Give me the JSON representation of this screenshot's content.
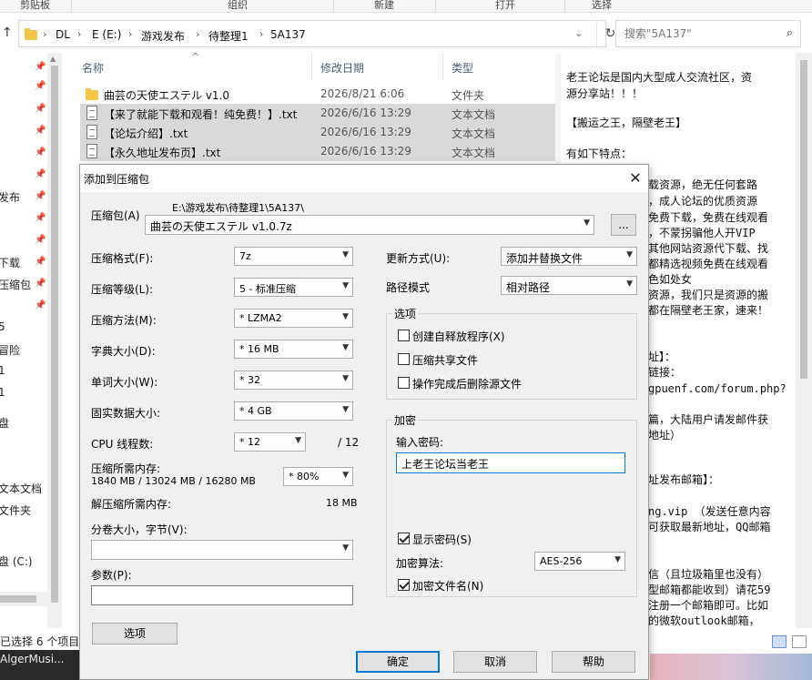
{
  "ribbon": {
    "groups": [
      "剪贴板",
      "组织",
      "新建",
      "打开",
      "选择"
    ]
  },
  "address": {
    "crumbs": [
      "DL",
      "E (E:)",
      "游戏发布",
      "待整理1",
      "5A137"
    ],
    "search_placeholder": "搜索\"5A137\""
  },
  "nav_pane": {
    "labels": [
      "发布",
      "下载",
      "压缩包",
      "5",
      "冒险",
      "1",
      "1",
      "盘",
      "文本文档",
      "文件夹",
      "盘 (C:)"
    ]
  },
  "file_list": {
    "columns": [
      "名称",
      "修改日期",
      "类型"
    ],
    "rows": [
      {
        "name": "曲芸の天使エステル v1.0",
        "date": "2026/8/21 6:06",
        "type": "文件夹",
        "icon": "folder-icon",
        "selected": false
      },
      {
        "name": "【来了就能下载和观看！纯免费！】.txt",
        "date": "2026/6/16 13:29",
        "type": "文本文档",
        "icon": "text-file-icon",
        "selected": true
      },
      {
        "name": "【论坛介绍】.txt",
        "date": "2026/6/16 13:29",
        "type": "文本文档",
        "icon": "text-file-icon",
        "selected": true
      },
      {
        "name": "【永久地址发布页】.txt",
        "date": "2026/6/16 13:29",
        "type": "文本文档",
        "icon": "text-file-icon",
        "selected": true
      }
    ]
  },
  "preview": {
    "lines_top": [
      "老王论坛是国内大型成人交流社区，资",
      "源分享站！！！",
      "",
      "【搬运之王，隔壁老王】",
      "",
      "有如下特点："
    ],
    "lines_right": [
      "载资源，绝无任何套路",
      "，成人论坛的优质资源",
      "免费下载，免费在线观看",
      "，不蒙拐骗他人开VIP",
      "其他网站资源代下载、找",
      "都精选视频免费在线观看",
      "色如处女",
      "资源，我们只是资源的搬",
      "都在隔壁老王家，速来！",
      "",
      "",
      "址】：",
      "链接：",
      "gpuenf.com/forum.php?",
      "",
      "篇，大陆用户请发邮件获",
      "地址）",
      "",
      "",
      "址发布邮箱】：",
      "",
      "ng.vip  （发送任意内容",
      "可获取最新地址，QQ邮箱",
      "",
      "",
      "信（且垃圾箱里也没有）",
      "型邮箱都能收到）请花59",
      "注册一个邮箱即可。比如",
      "的微软outlook邮箱，"
    ]
  },
  "status": {
    "text": "已选择 6 个项目"
  },
  "taskbar": {
    "app_label": "AlgerMusi..."
  },
  "dialog": {
    "title": "添加到压缩包",
    "archive_label": "压缩包(A)",
    "archive_path": "E:\\游戏发布\\待整理1\\5A137\\",
    "archive_name": "曲芸の天使エステル v1.0.7z",
    "browse_label": "...",
    "format_label": "压缩格式(F):",
    "format_value": "7z",
    "level_label": "压缩等级(L):",
    "level_value": "5 - 标准压缩",
    "method_label": "压缩方法(M):",
    "method_value": "* LZMA2",
    "dict_label": "字典大小(D):",
    "dict_value": "* 16 MB",
    "word_label": "单词大小(W):",
    "word_value": "* 32",
    "solid_label": "固实数据大小:",
    "solid_value": "* 4 GB",
    "threads_label": "CPU 线程数:",
    "threads_value": "* 12",
    "threads_total": "/ 12",
    "mem_label": "压缩所需内存:",
    "mem_values": "1840 MB / 13024 MB / 16280 MB",
    "mem_percent": "* 80%",
    "decomp_label": "解压缩所需内存:",
    "decomp_value": "18 MB",
    "split_label": "分卷大小，字节(V):",
    "split_value": "",
    "params_label": "参数(P):",
    "params_value": "",
    "options_button": "选项",
    "update_label": "更新方式(U):",
    "update_value": "添加并替换文件",
    "pathmode_label": "路径模式",
    "pathmode_value": "相对路径",
    "options_group": "选项",
    "opt_sfx": "创建自释放程序(X)",
    "opt_shared": "压缩共享文件",
    "opt_delete": "操作完成后删除源文件",
    "encrypt_group": "加密",
    "password_label": "输入密码:",
    "password_value": "上老王论坛当老王",
    "show_password": "显示密码(S)",
    "algo_label": "加密算法:",
    "algo_value": "AES-256",
    "encrypt_names": "加密文件名(N)",
    "ok": "确定",
    "cancel": "取消",
    "help": "帮助"
  }
}
